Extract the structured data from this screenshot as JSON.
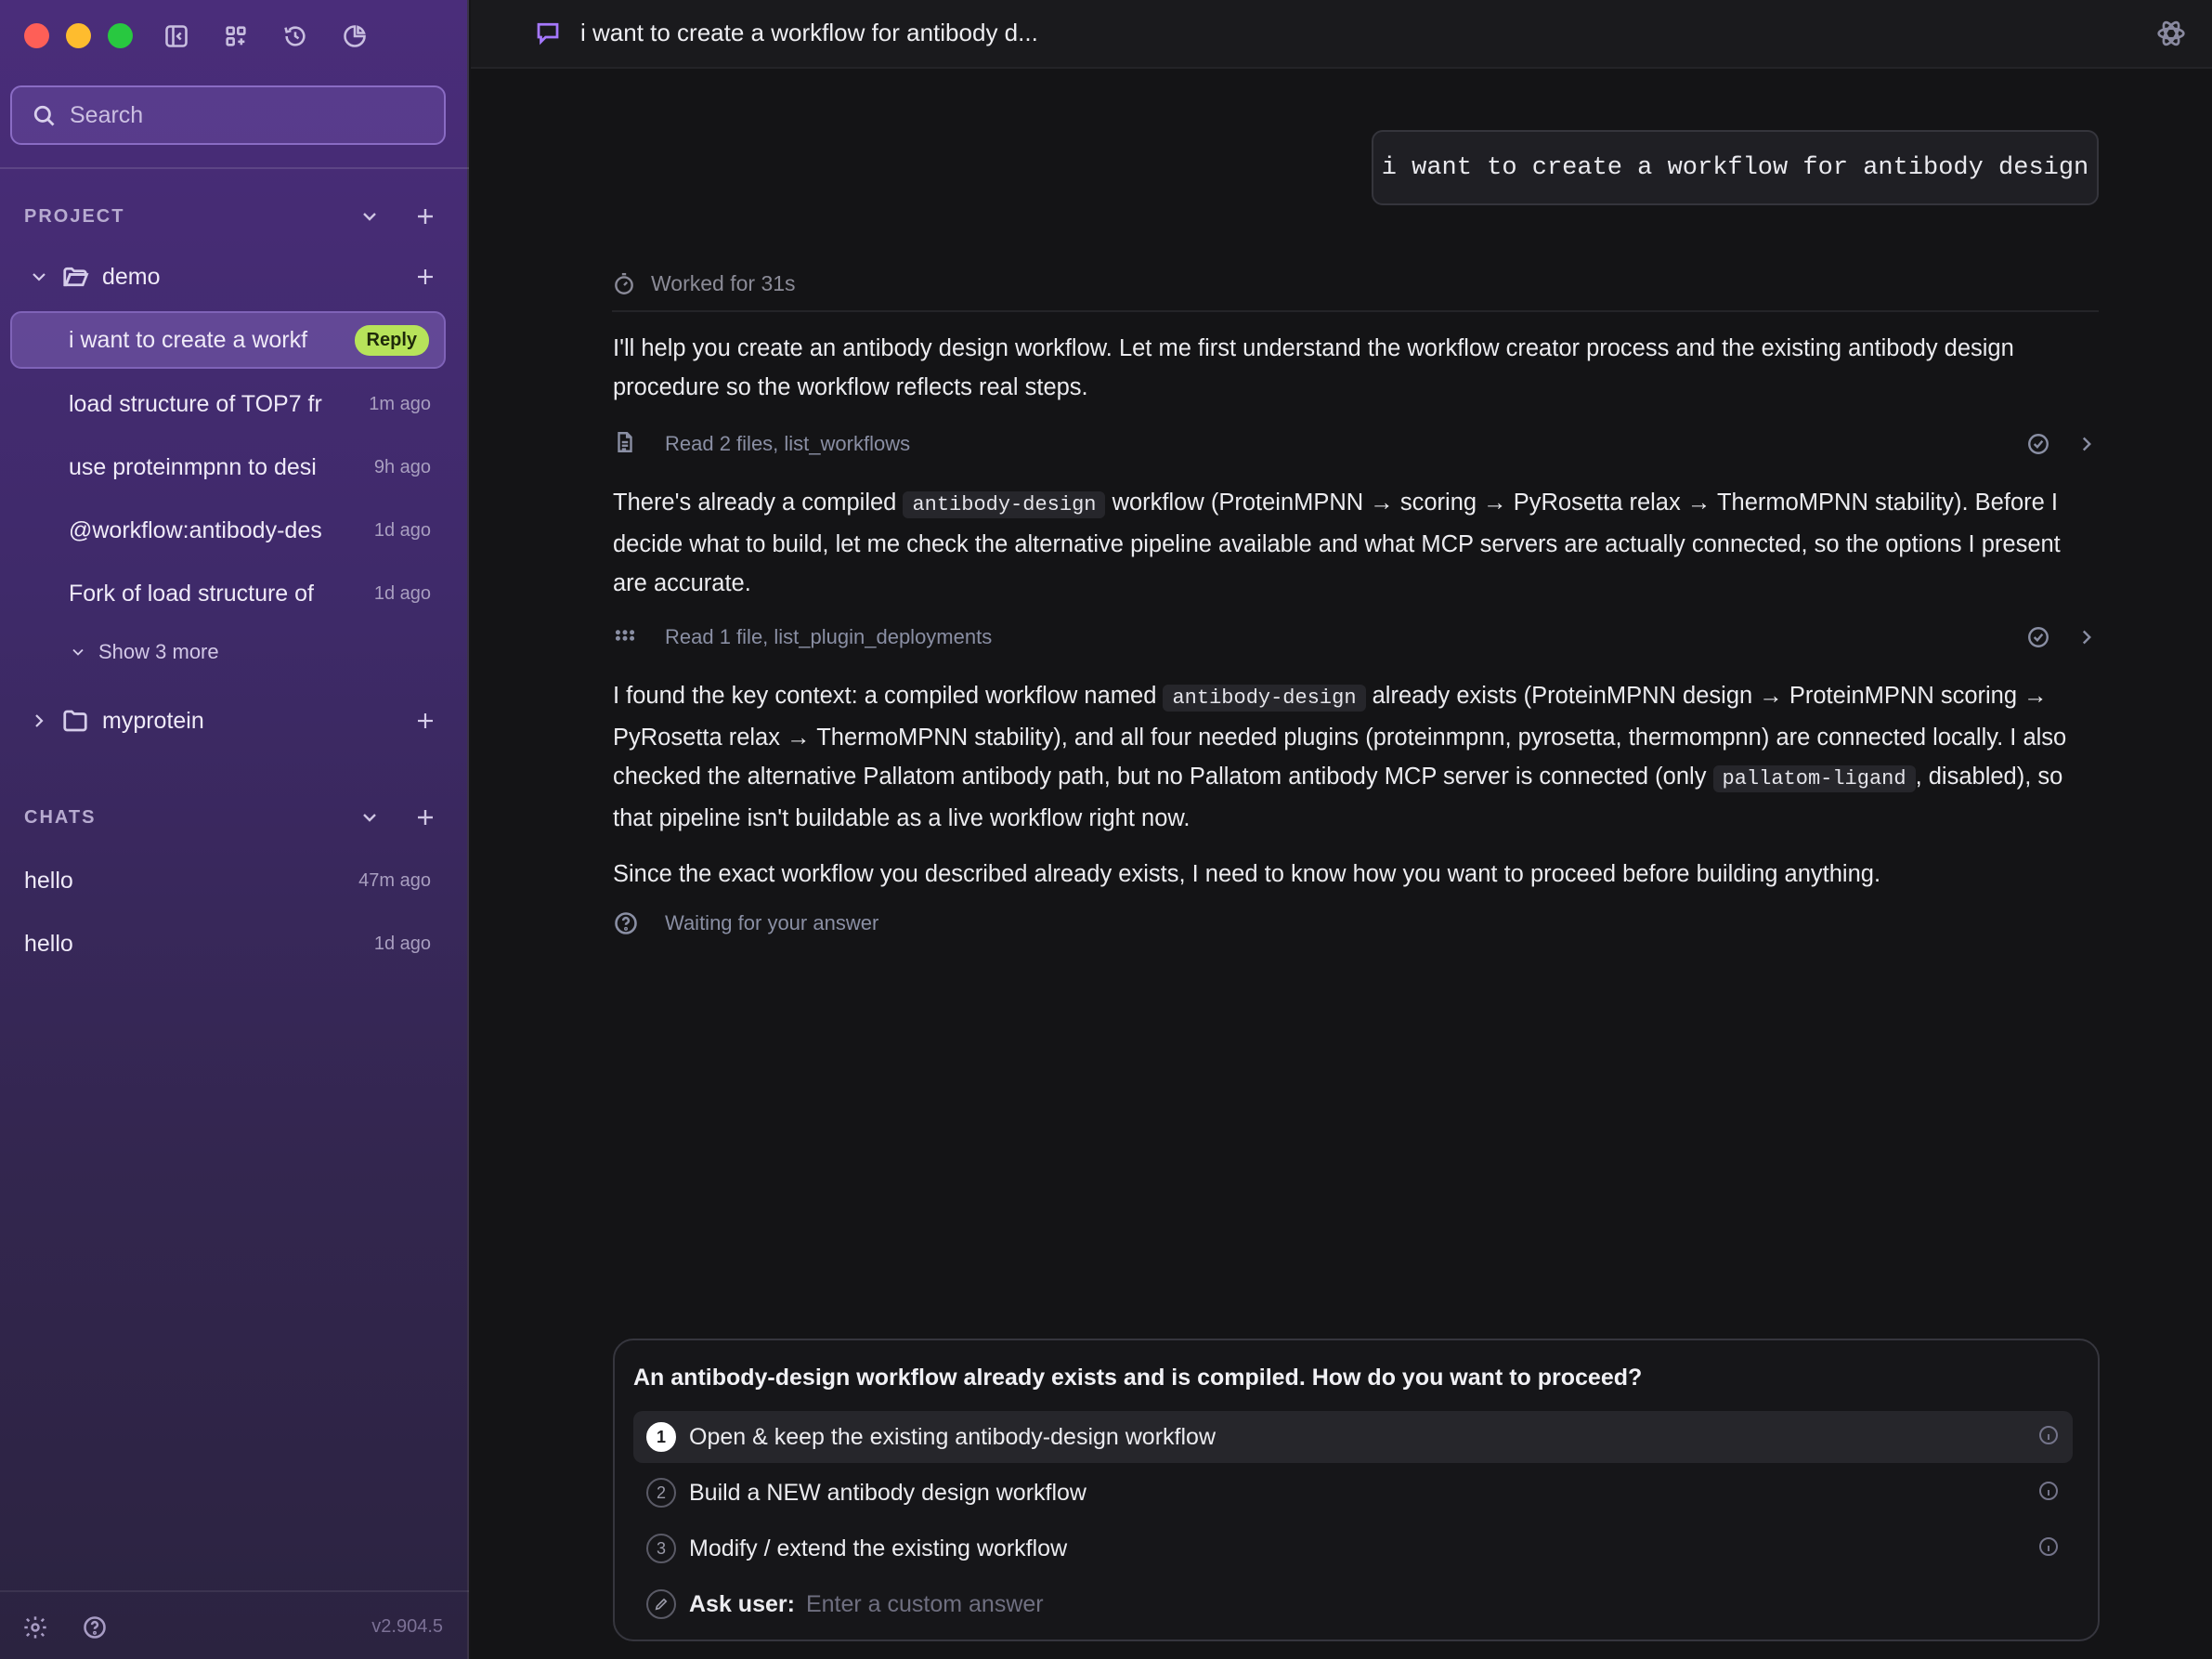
{
  "sidebar": {
    "search_placeholder": "Search",
    "project_section_label": "PROJECT",
    "folders": [
      {
        "name": "demo",
        "expanded": true
      },
      {
        "name": "myprotein",
        "expanded": false
      }
    ],
    "demo_items": [
      {
        "title": "i want to create a workf",
        "badge": "Reply",
        "active": true
      },
      {
        "title": "load structure of TOP7 fr",
        "time": "1m ago"
      },
      {
        "title": "use proteinmpnn to desi",
        "time": "9h ago"
      },
      {
        "title": "@workflow:antibody-des",
        "time": "1d ago"
      },
      {
        "title": "Fork of load structure of",
        "time": "1d ago"
      }
    ],
    "show_more_label": "Show 3 more",
    "chats_section_label": "CHATS",
    "chats": [
      {
        "title": "hello",
        "time": "47m ago"
      },
      {
        "title": "hello",
        "time": "1d ago"
      }
    ],
    "version": "v2.904.5"
  },
  "header": {
    "title": "i want to create a workflow for antibody d..."
  },
  "conversation": {
    "user_message": "i want to create a workflow for antibody design",
    "worked_label": "Worked for 31s",
    "para1": "I'll help you create an antibody design workflow. Let me first understand the workflow creator process and the existing antibody design procedure so the workflow reflects real steps.",
    "tool1_label": "Read 2 files, list_workflows",
    "para2_pre": "There's already a compiled ",
    "para2_code": "antibody-design",
    "para2_post": " workflow (ProteinMPNN → scoring → PyRosetta relax → ThermoMPNN stability). Before I decide what to build, let me check the alternative pipeline available and what MCP servers are actually connected, so the options I present are accurate.",
    "tool2_label": "Read 1 file, list_plugin_deployments",
    "para3_pre": "I found the key context: a compiled workflow named ",
    "para3_code1": "antibody-design",
    "para3_mid": " already exists (ProteinMPNN design → ProteinMPNN scoring → PyRosetta relax → ThermoMPNN stability), and all four needed plugins (proteinmpnn, pyrosetta, thermompnn) are connected locally. I also checked the alternative Pallatom antibody path, but no Pallatom antibody MCP server is connected (only ",
    "para3_code2": "pallatom-ligand",
    "para3_post": ", disabled), so that pipeline isn't buildable as a live workflow right now.",
    "para4": "Since the exact workflow you described already exists, I need to know how you want to proceed before building anything.",
    "waiting_label": "Waiting for your answer"
  },
  "question": {
    "prompt": "An antibody-design workflow already exists and is compiled. How do you want to proceed?",
    "options": [
      {
        "num": "1",
        "label": "Open & keep the existing antibody-design workflow",
        "selected": true
      },
      {
        "num": "2",
        "label": "Build a NEW antibody design workflow",
        "selected": false
      },
      {
        "num": "3",
        "label": "Modify / extend the existing workflow",
        "selected": false
      }
    ],
    "ask_label": "Ask user:",
    "ask_placeholder": "Enter a custom answer"
  },
  "colors": {
    "accent_purple": "#a678ff",
    "reply_badge": "#b7e35a",
    "traffic_red": "#fe5f57",
    "traffic_yellow": "#febc2e",
    "traffic_green": "#28c840"
  }
}
